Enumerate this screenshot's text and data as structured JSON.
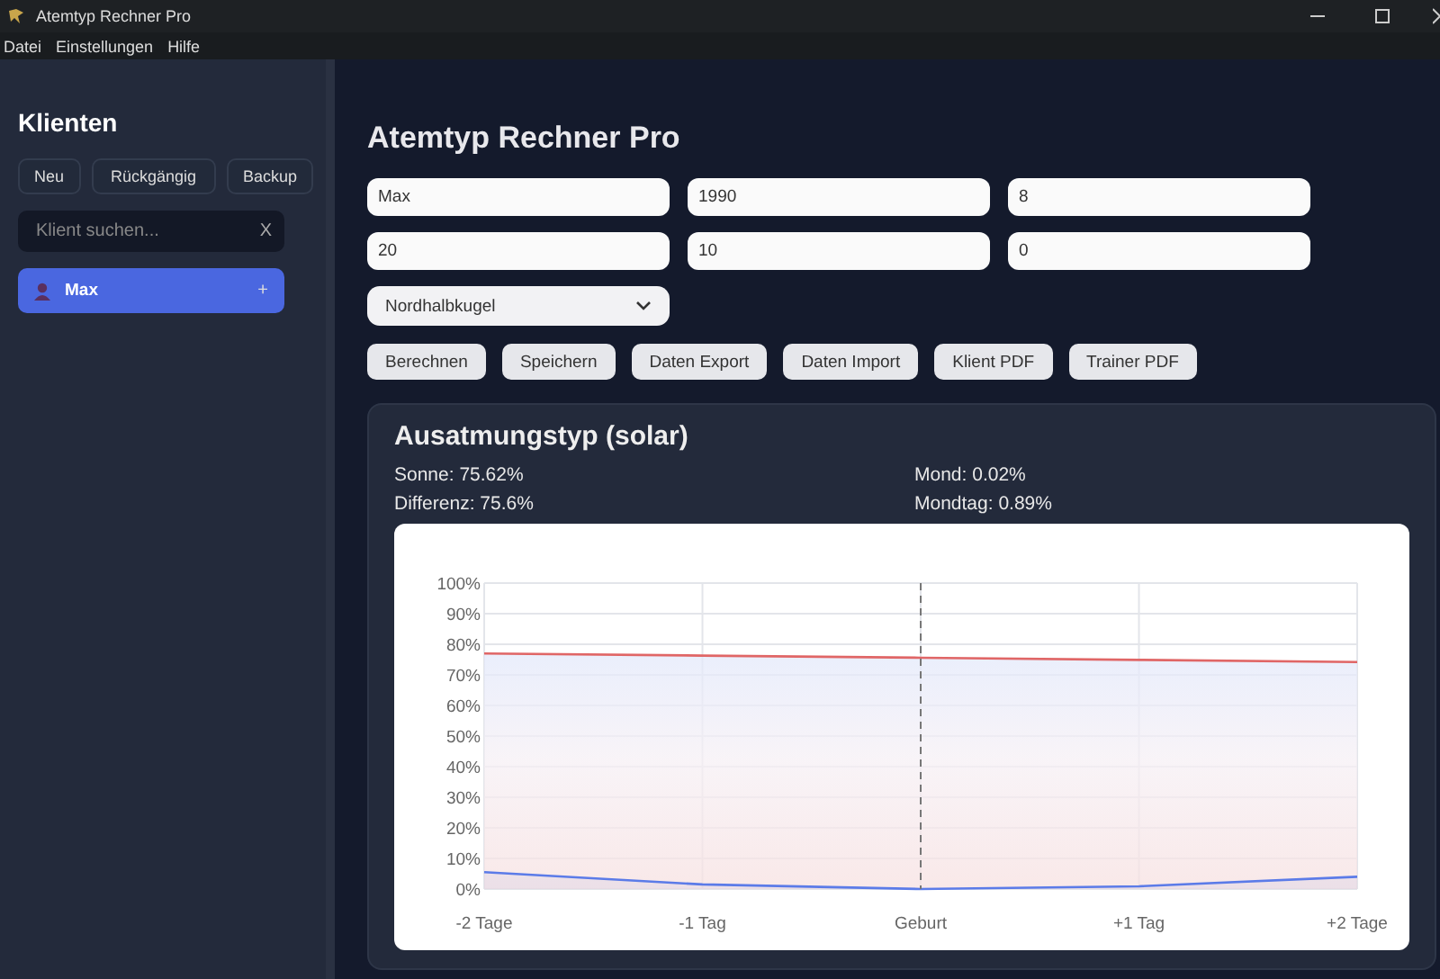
{
  "window": {
    "title": "Atemtyp Rechner Pro"
  },
  "menu": [
    "Datei",
    "Einstellungen",
    "Hilfe"
  ],
  "sidebar": {
    "title": "Klienten",
    "buttons": [
      "Neu",
      "Rückgängig",
      "Backup"
    ],
    "search": {
      "placeholder": "Klient suchen...",
      "clear": "X"
    },
    "clients": [
      {
        "name": "Max",
        "action": "+",
        "selected": true
      }
    ]
  },
  "main": {
    "title": "Atemtyp Rechner Pro",
    "fields": [
      {
        "value": "Max"
      },
      {
        "value": "1990"
      },
      {
        "value": "8"
      },
      {
        "value": "20"
      },
      {
        "value": "10"
      },
      {
        "value": "0"
      }
    ],
    "hemisphere": {
      "value": "Nordhalbkugel"
    },
    "buttons": [
      "Berechnen",
      "Speichern",
      "Daten Export",
      "Daten Import",
      "Klient PDF",
      "Trainer PDF"
    ],
    "result": {
      "title": "Ausatmungstyp (solar)",
      "stats": [
        "Sonne: 75.62%",
        "Mond: 0.02%",
        "Differenz: 75.6%",
        "Mondtag: 0.89%"
      ],
      "chart_data": {
        "type": "area",
        "categories": [
          "-2 Tage",
          "-1 Tag",
          "Geburt",
          "+1 Tag",
          "+2 Tage"
        ],
        "series": [
          {
            "color": "#e06666",
            "values": [
              77,
              76.3,
              75.6,
              74.9,
              74.2
            ]
          },
          {
            "color": "#5b7be8",
            "values": [
              5.5,
              1.5,
              0,
              0.9,
              4
            ]
          }
        ],
        "ylim": [
          0,
          100
        ],
        "yticks": [
          {
            "value": 0,
            "label": "0%"
          },
          {
            "value": 10,
            "label": "10%"
          },
          {
            "value": 20,
            "label": "20%"
          },
          {
            "value": 30,
            "label": "30%"
          },
          {
            "value": 40,
            "label": "40%"
          },
          {
            "value": 50,
            "label": "50%"
          },
          {
            "value": 60,
            "label": "60%"
          },
          {
            "value": 70,
            "label": "70%"
          },
          {
            "value": 80,
            "label": "80%"
          },
          {
            "value": 90,
            "label": "90%"
          },
          {
            "value": 100,
            "label": "100%"
          }
        ],
        "grid": true,
        "ref_lines": [
          {
            "axis": "x",
            "value": "Geburt"
          }
        ]
      }
    }
  }
}
